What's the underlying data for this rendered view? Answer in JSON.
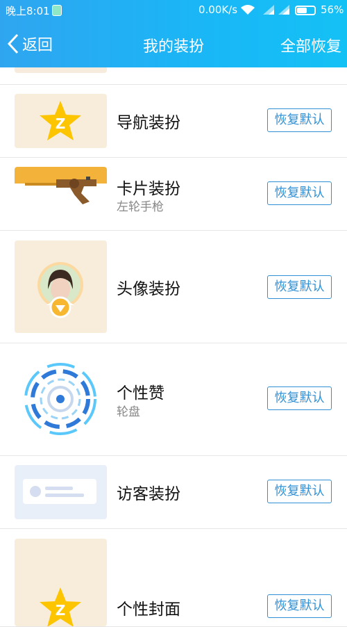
{
  "status_bar": {
    "time": "晚上8:01",
    "speed": "0.00K/s",
    "battery": "56%"
  },
  "nav": {
    "back_label": "返回",
    "title": "我的装扮",
    "right_action": "全部恢复"
  },
  "items": [
    {
      "title": "导航装扮",
      "subtitle": "",
      "button": "恢复默认"
    },
    {
      "title": "卡片装扮",
      "subtitle": "左轮手枪",
      "button": "恢复默认"
    },
    {
      "title": "头像装扮",
      "subtitle": "",
      "button": "恢复默认"
    },
    {
      "title": "个性赞",
      "subtitle": "轮盘",
      "button": "恢复默认"
    },
    {
      "title": "访客装扮",
      "subtitle": "",
      "button": "恢复默认"
    },
    {
      "title": "个性封面",
      "subtitle": "",
      "button": "恢复默认"
    }
  ],
  "colors": {
    "header_start": "#2fa5f0",
    "header_end": "#14c1f5",
    "button_border": "#2f90d6",
    "page_bg": "#f5f5f7"
  }
}
